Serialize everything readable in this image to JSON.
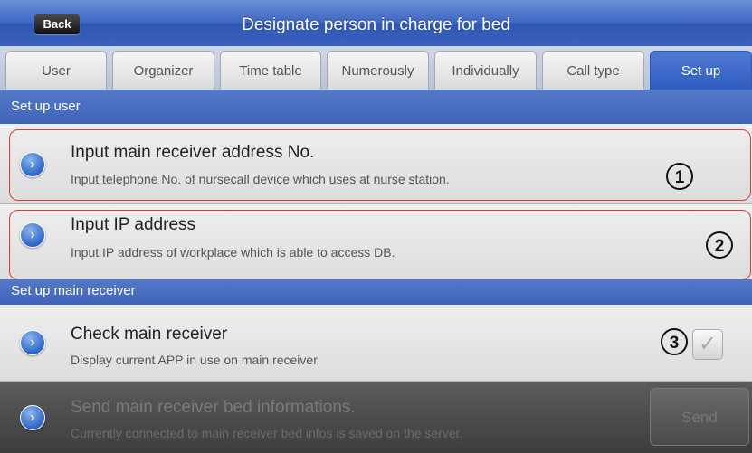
{
  "header": {
    "back_label": "Back",
    "title": "Designate person in charge for bed"
  },
  "tabs": [
    "User",
    "Organizer",
    "Time table",
    "Numerously",
    "Individually",
    "Call type",
    "Set up"
  ],
  "sections": {
    "set_up_user": "Set up user",
    "set_up_main_receiver": "Set up main receiver"
  },
  "rows": [
    {
      "title": "Input main receiver address No.",
      "subtitle": "Input telephone No. of nursecall device which uses at nurse station."
    },
    {
      "title": "Input IP address",
      "subtitle": "Input IP address of workplace which is able to access DB."
    },
    {
      "title": "Check main receiver",
      "subtitle": "Display current APP in use on main receiver",
      "checked": true
    },
    {
      "title": "Send main receiver bed informations.",
      "subtitle": "Currently connected to main receiver bed infos is saved on the server.",
      "disabled": true
    }
  ],
  "send_label": "Send",
  "markers": [
    "1",
    "2",
    "3"
  ],
  "colors": {
    "accent": "#3f68c4",
    "highlight": "#e23838"
  }
}
